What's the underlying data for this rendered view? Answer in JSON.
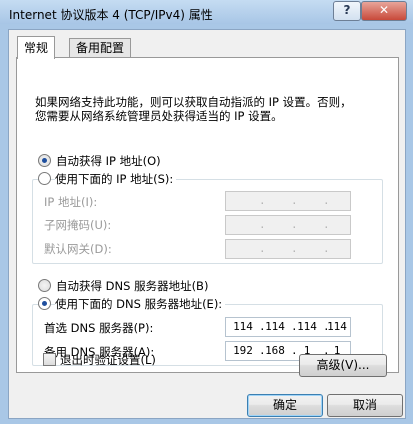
{
  "window": {
    "title": "Internet 协议版本 4 (TCP/IPv4) 属性",
    "help_label": "?",
    "close_label": "✕"
  },
  "tabs": [
    {
      "label": "常规",
      "active": true
    },
    {
      "label": "备用配置",
      "active": false
    }
  ],
  "description": {
    "line1": "如果网络支持此功能，则可以获取自动指派的 IP 设置。否则，",
    "line2": "您需要从网络系统管理员处获得适当的 IP 设置。"
  },
  "ip_section": {
    "auto_label": "自动获得 IP 地址(O)",
    "auto_checked": true,
    "manual_label": "使用下面的 IP 地址(S):",
    "manual_checked": false,
    "fields": [
      {
        "label": "IP 地址(I):",
        "octets": [
          "",
          "",
          "",
          ""
        ]
      },
      {
        "label": "子网掩码(U):",
        "octets": [
          "",
          "",
          "",
          ""
        ]
      },
      {
        "label": "默认网关(D):",
        "octets": [
          "",
          "",
          "",
          ""
        ]
      }
    ]
  },
  "dns_section": {
    "auto_label": "自动获得 DNS 服务器地址(B)",
    "auto_checked": false,
    "manual_label": "使用下面的 DNS 服务器地址(E):",
    "manual_checked": true,
    "fields": [
      {
        "label": "首选 DNS 服务器(P):",
        "octets": [
          "114",
          "114",
          "114",
          "114"
        ]
      },
      {
        "label": "备用 DNS 服务器(A):",
        "octets": [
          "192",
          "168",
          "1",
          "1"
        ]
      }
    ]
  },
  "validate_on_exit": {
    "label": "退出时验证设置(L)",
    "checked": false
  },
  "buttons": {
    "advanced": "高级(V)...",
    "ok": "确定",
    "cancel": "取消"
  },
  "dot": "."
}
